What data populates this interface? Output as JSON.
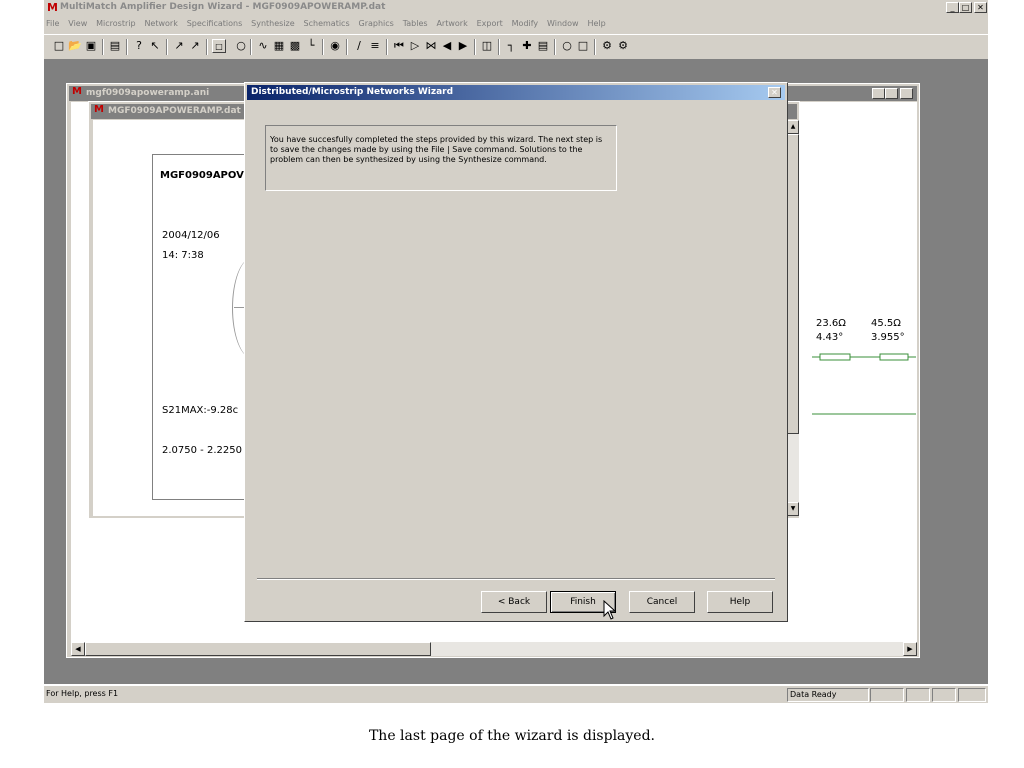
{
  "app": {
    "title": "MultiMatch Amplifier Design Wizard - MGF0909APOWERAMP.dat",
    "controls": [
      "_",
      "□",
      "✕"
    ]
  },
  "menu": [
    "File",
    "View",
    "Microstrip",
    "Network",
    "Specifications",
    "Synthesize",
    "Schematics",
    "Graphics",
    "Tables",
    "Artwork",
    "Export",
    "Modify",
    "Window",
    "Help"
  ],
  "toolbar_icons": [
    "new-icon",
    "open-icon",
    "save-icon",
    "print-icon",
    "help-icon",
    "context-help-icon",
    "tool-a-icon",
    "tool-b-icon",
    "tool-c-icon",
    "circle-icon",
    "tool-d-icon",
    "grid-icon",
    "tool-e-icon",
    "tool-f-icon",
    "target-icon",
    "tool-g-icon",
    "tool-h-icon",
    "first-icon",
    "play-icon",
    "next-icon",
    "prev-icon",
    "last-icon",
    "tool-i-icon",
    "tool-j-icon",
    "tool-k-icon",
    "tool-l-icon",
    "tool-m-icon",
    "tool-n-icon",
    "tool-o-icon",
    "tool-p-icon"
  ],
  "outer_window": {
    "title": "mgf0909apoweramp.ani",
    "controls": [
      "_",
      "□",
      "✕"
    ]
  },
  "inner_window": {
    "title": "MGF0909APOWERAMP.dat"
  },
  "document": {
    "title": "MGF0909APOV",
    "date": "2004/12/06",
    "time": "14: 7:38",
    "s21": "S21MAX:-9.28c",
    "range": "2.0750 - 2.2250"
  },
  "schematic": {
    "z1": "23.6Ω",
    "a1": "4.43°",
    "z2": "45.5Ω",
    "a2": "3.955°"
  },
  "wizard": {
    "title": "Distributed/Microstrip Networks Wizard",
    "close": "✕",
    "message": "You have succesfully completed the steps provided by this wizard. The next step is to save the changes made by using the File | Save command. Solutions to the problem can then be synthesized by using the Synthesize command.",
    "back": "< Back",
    "finish": "Finish",
    "cancel": "Cancel",
    "help": "Help"
  },
  "status": {
    "help": "For Help, press F1",
    "state": "Data Ready"
  },
  "caption": "The last page of the wizard is displayed."
}
